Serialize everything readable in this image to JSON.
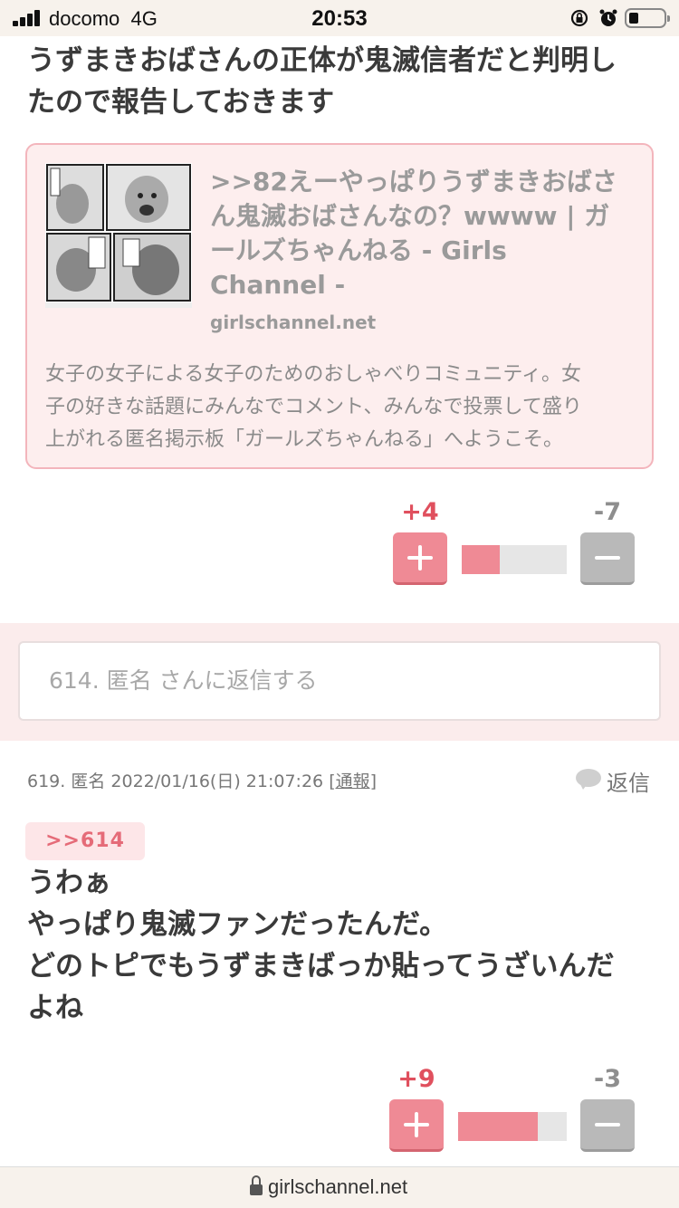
{
  "status_bar": {
    "carrier": "docomo",
    "network": "4G",
    "time": "20:53",
    "icons": [
      "orientation-lock-icon",
      "alarm-icon",
      "battery-icon"
    ]
  },
  "comment_614": {
    "text_lines": [
      "うずまきおばさんの正体が鬼滅信者だと判明し",
      "たので報告しておきます"
    ],
    "link_card": {
      "title_lines": [
        ">>82えーやっぱりうずまきおばさ",
        "ん鬼滅おばさんなの？wwww | ガ",
        "ールズちゃんねる - Girls",
        "Channel -"
      ],
      "domain": "girlschannel.net",
      "description_lines": [
        "女子の女子による女子のためのおしゃべりコミュニティ。女",
        "子の好きな話題にみんなでコメント、みんなで投票して盛り",
        "上がれる匿名掲示板「ガールズちゃんねる」へようこそ。"
      ]
    },
    "votes": {
      "plus": "+4",
      "minus": "-7",
      "plus_ratio": 0.36
    }
  },
  "reply_form": {
    "placeholder": "614. 匿名 さんに返信する"
  },
  "comment_619": {
    "number": "619.",
    "author": "匿名",
    "datetime": "2022/01/16(日) 21:07:26",
    "report_label": "[通報]",
    "reply_label": "返信",
    "anchor": ">>614",
    "text_lines": [
      "うわぁ",
      "やっぱり鬼滅ファンだったんだ。",
      "どのトピでもうずまきばっか貼ってうざいんだ",
      "よね"
    ],
    "votes": {
      "plus": "+9",
      "minus": "-3",
      "plus_ratio": 0.73
    }
  },
  "bottom_bar": {
    "domain": "girlschannel.net"
  },
  "colors": {
    "accent_pink": "#ef8a95",
    "vote_plus_text": "#e0505e",
    "card_bg": "#fdeeee",
    "reply_band_bg": "#fbecec"
  }
}
